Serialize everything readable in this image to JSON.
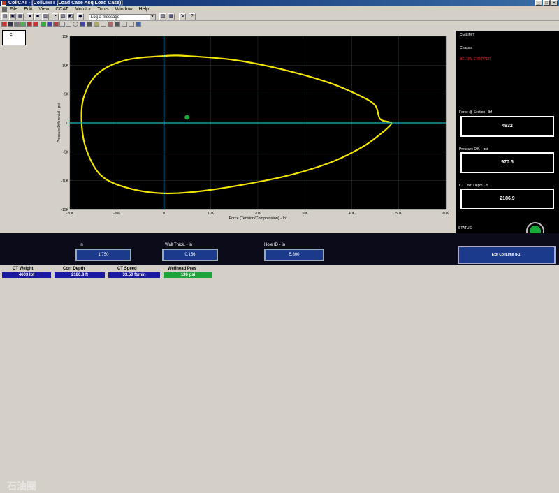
{
  "window": {
    "title": "CoilCAT - [CoilLIMIT (Load Case Acq Load Case)]",
    "controls": [
      "_",
      "□",
      "×"
    ]
  },
  "menu": [
    "File",
    "Edit",
    "View",
    "CCAT",
    "Monitor",
    "Tools",
    "Window",
    "Help"
  ],
  "toolbar": {
    "log_select": "Log a message"
  },
  "side_box": "c",
  "chart_data": {
    "type": "line",
    "xlabel": "Force (Tension/Compression) - lbf",
    "ylabel": "Pressure Differential - psi",
    "x_ticks": [
      "-20K",
      "-10K",
      "0",
      "10K",
      "20K",
      "30K",
      "40K",
      "50K",
      "60K"
    ],
    "y_ticks": [
      "15K",
      "10K",
      "5K",
      "0",
      "-5K",
      "-10K",
      "-15K"
    ],
    "xlim": [
      -20000,
      60000
    ],
    "ylim": [
      -15000,
      15000
    ],
    "grid": true,
    "background": "#000000",
    "curve_color": "#f2e600",
    "axis_color": "#19b5c4",
    "envelope": {
      "x": [
        48500,
        48000,
        46000,
        45000,
        42000,
        35000,
        25000,
        15000,
        5000,
        0,
        -8000,
        -14000,
        -17000,
        -17500,
        -16500,
        -13500,
        -8000,
        0,
        10000,
        25000,
        35000,
        42000,
        46000,
        48000,
        48500
      ],
      "y": [
        0,
        150,
        700,
        3000,
        4600,
        7000,
        9300,
        10900,
        11600,
        11600,
        10900,
        8600,
        4600,
        0,
        -4600,
        -9000,
        -11200,
        -12200,
        -11600,
        -9400,
        -7000,
        -4300,
        -2000,
        -600,
        0
      ]
    },
    "operating_point": {
      "x": 4932,
      "y": 970.5,
      "color": "#19a83a"
    }
  },
  "right_panel": {
    "title": "CoilLIMIT",
    "subtitle": "Chassis",
    "warning": "BELOW STRIPPER",
    "warning_color": "#e03030",
    "readouts": [
      {
        "label": "Force @ Section - lbf",
        "value": "4932"
      },
      {
        "label": "Pressure Diff. - psi",
        "value": "970.5"
      },
      {
        "label": "CT Corr. Depth - ft",
        "value": "2186.9"
      }
    ],
    "status_label": "STATUS",
    "status_color": "#1aa83a"
  },
  "bottom_fields": [
    {
      "label": "in",
      "value": "1.750"
    },
    {
      "label": "Wall Thick. - in",
      "value": "0.156"
    },
    {
      "label": "Hole ID - in",
      "value": "5.800"
    }
  ],
  "exit_button": "Exit CoilLimit (F1)",
  "statusbar": [
    {
      "label": "CT Weight",
      "value": "4603 lbf",
      "color": "#1a1aa0"
    },
    {
      "label": "Corr Depth",
      "value": "2186.8 ft",
      "color": "#1a1aa0"
    },
    {
      "label": "CT Speed",
      "value": "33.50 ft/min",
      "color": "#1a1aa0"
    },
    {
      "label": "Wellhead Pres",
      "value": "136 psi",
      "color": "#1ea33a"
    }
  ],
  "watermark": "石油圈"
}
